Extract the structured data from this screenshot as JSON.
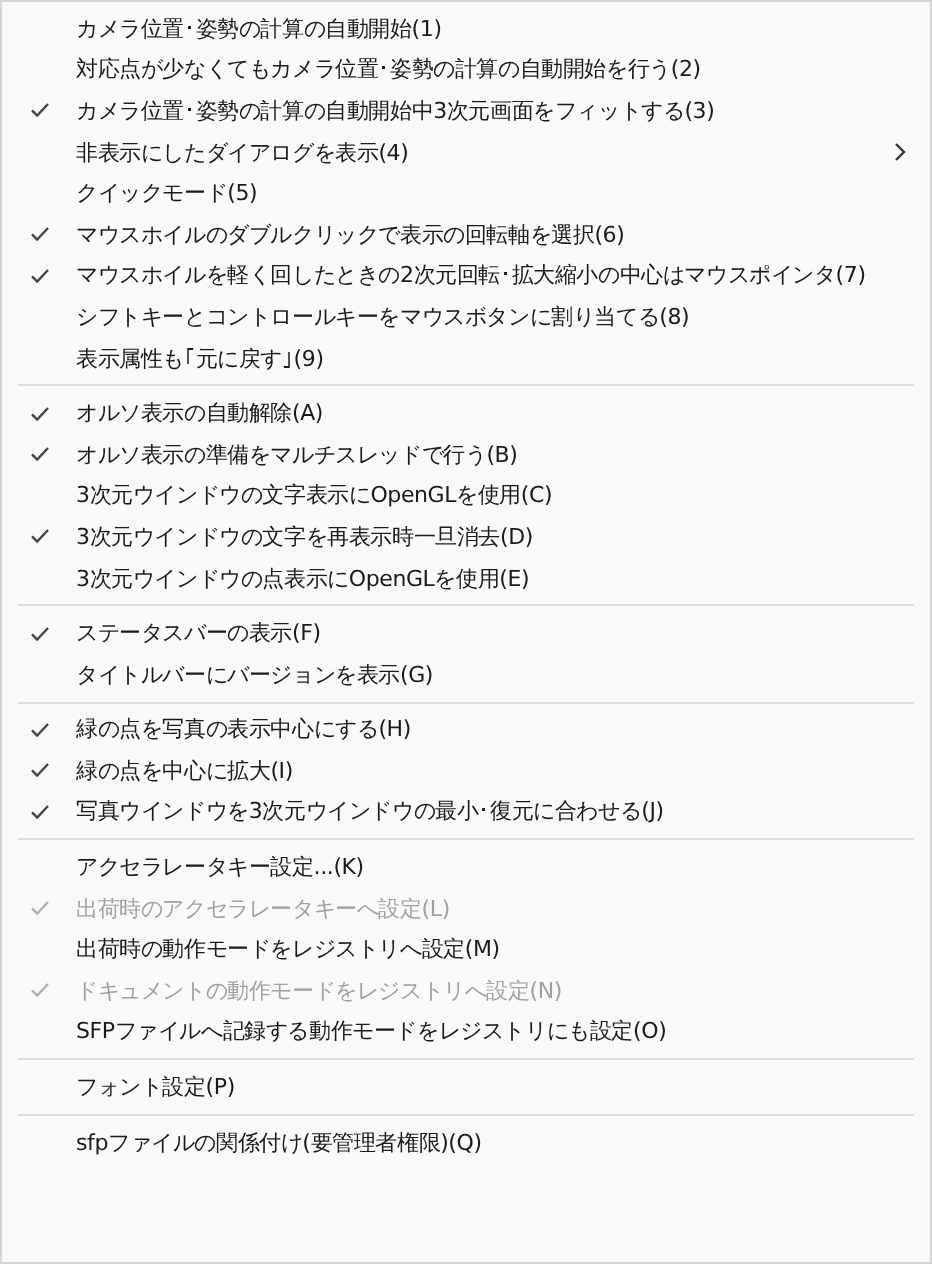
{
  "menu": {
    "items": [
      {
        "kind": "item",
        "label": "カメラ位置･姿勢の計算の自動開始(1)",
        "checked": false,
        "disabled": false,
        "submenu": false
      },
      {
        "kind": "item",
        "label": "対応点が少なくてもカメラ位置･姿勢の計算の自動開始を行う(2)",
        "checked": false,
        "disabled": false,
        "submenu": false
      },
      {
        "kind": "item",
        "label": "カメラ位置･姿勢の計算の自動開始中3次元画面をフィットする(3)",
        "checked": true,
        "disabled": false,
        "submenu": false
      },
      {
        "kind": "item",
        "label": "非表示にしたダイアログを表示(4)",
        "checked": false,
        "disabled": false,
        "submenu": true
      },
      {
        "kind": "item",
        "label": "クイックモード(5)",
        "checked": false,
        "disabled": false,
        "submenu": false
      },
      {
        "kind": "item",
        "label": "マウスホイルのダブルクリックで表示の回転軸を選択(6)",
        "checked": true,
        "disabled": false,
        "submenu": false
      },
      {
        "kind": "item",
        "label": "マウスホイルを軽く回したときの2次元回転･拡大縮小の中心はマウスポインタ(7)",
        "checked": true,
        "disabled": false,
        "submenu": false
      },
      {
        "kind": "item",
        "label": "シフトキーとコントロールキーをマウスボタンに割り当てる(8)",
        "checked": false,
        "disabled": false,
        "submenu": false
      },
      {
        "kind": "item",
        "label": "表示属性も｢元に戻す｣(9)",
        "checked": false,
        "disabled": false,
        "submenu": false
      },
      {
        "kind": "separator"
      },
      {
        "kind": "item",
        "label": "オルソ表示の自動解除(A)",
        "checked": true,
        "disabled": false,
        "submenu": false
      },
      {
        "kind": "item",
        "label": "オルソ表示の準備をマルチスレッドで行う(B)",
        "checked": true,
        "disabled": false,
        "submenu": false
      },
      {
        "kind": "item",
        "label": "3次元ウインドウの文字表示にOpenGLを使用(C)",
        "checked": false,
        "disabled": false,
        "submenu": false
      },
      {
        "kind": "item",
        "label": "3次元ウインドウの文字を再表示時一旦消去(D)",
        "checked": true,
        "disabled": false,
        "submenu": false
      },
      {
        "kind": "item",
        "label": "3次元ウインドウの点表示にOpenGLを使用(E)",
        "checked": false,
        "disabled": false,
        "submenu": false
      },
      {
        "kind": "separator"
      },
      {
        "kind": "item",
        "label": "ステータスバーの表示(F)",
        "checked": true,
        "disabled": false,
        "submenu": false
      },
      {
        "kind": "item",
        "label": "タイトルバーにバージョンを表示(G)",
        "checked": false,
        "disabled": false,
        "submenu": false
      },
      {
        "kind": "separator"
      },
      {
        "kind": "item",
        "label": "緑の点を写真の表示中心にする(H)",
        "checked": true,
        "disabled": false,
        "submenu": false
      },
      {
        "kind": "item",
        "label": "緑の点を中心に拡大(I)",
        "checked": true,
        "disabled": false,
        "submenu": false
      },
      {
        "kind": "item",
        "label": "写真ウインドウを3次元ウインドウの最小･復元に合わせる(J)",
        "checked": true,
        "disabled": false,
        "submenu": false
      },
      {
        "kind": "separator"
      },
      {
        "kind": "item",
        "label": "アクセラレータキー設定...(K)",
        "checked": false,
        "disabled": false,
        "submenu": false
      },
      {
        "kind": "item",
        "label": "出荷時のアクセラレータキーへ設定(L)",
        "checked": true,
        "disabled": true,
        "submenu": false
      },
      {
        "kind": "item",
        "label": "出荷時の動作モードをレジストリへ設定(M)",
        "checked": false,
        "disabled": false,
        "submenu": false
      },
      {
        "kind": "item",
        "label": "ドキュメントの動作モードをレジストリへ設定(N)",
        "checked": true,
        "disabled": true,
        "submenu": false
      },
      {
        "kind": "item",
        "label": "SFPファイルへ記録する動作モードをレジストリにも設定(O)",
        "checked": false,
        "disabled": false,
        "submenu": false
      },
      {
        "kind": "separator"
      },
      {
        "kind": "item",
        "label": "フォント設定(P)",
        "checked": false,
        "disabled": false,
        "submenu": false
      },
      {
        "kind": "separator"
      },
      {
        "kind": "item",
        "label": "sfpファイルの関係付け(要管理者権限)(Q)",
        "checked": false,
        "disabled": false,
        "submenu": false
      }
    ]
  }
}
